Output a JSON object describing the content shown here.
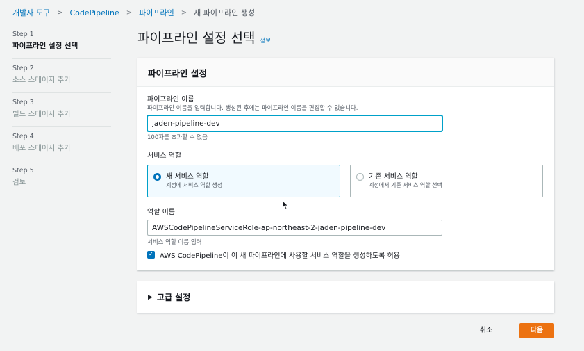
{
  "breadcrumb": {
    "items": [
      "개발자 도구",
      "CodePipeline",
      "파이프라인",
      "새 파이프라인 생성"
    ]
  },
  "steps": [
    {
      "num": "Step 1",
      "label": "파이프라인 설정 선택"
    },
    {
      "num": "Step 2",
      "label": "소스 스테이지 추가"
    },
    {
      "num": "Step 3",
      "label": "빌드 스테이지 추가"
    },
    {
      "num": "Step 4",
      "label": "배포 스테이지 추가"
    },
    {
      "num": "Step 5",
      "label": "검토"
    }
  ],
  "page": {
    "title": "파이프라인 설정 선택",
    "info": "정보"
  },
  "panel": {
    "header": "파이프라인 설정",
    "pipeline_name": {
      "label": "파이프라인 이름",
      "desc": "파이프라인 이름을 입력합니다. 생성된 후에는 파이프라인 이름을 편집할 수 없습니다.",
      "value": "jaden-pipeline-dev",
      "constraint": "100자를 초과할 수 없음"
    },
    "service_role": {
      "label": "서비스 역할",
      "options": [
        {
          "title": "새 서비스 역할",
          "desc": "계정에 서비스 역할 생성"
        },
        {
          "title": "기존 서비스 역할",
          "desc": "계정에서 기존 서비스 역할 선택"
        }
      ]
    },
    "role_name": {
      "label": "역할 이름",
      "value": "AWSCodePipelineServiceRole-ap-northeast-2-jaden-pipeline-dev",
      "desc": "서비스 역할 이름 입력"
    },
    "checkbox_label": "AWS CodePipeline이 이 새 파이프라인에 사용할 서비스 역할을 생성하도록 허용"
  },
  "advanced": {
    "label": "고급 설정"
  },
  "footer": {
    "cancel": "취소",
    "next": "다음"
  },
  "colors": {
    "accent": "#ec7211",
    "link": "#0073bb",
    "selected_bg": "#f1faff"
  }
}
